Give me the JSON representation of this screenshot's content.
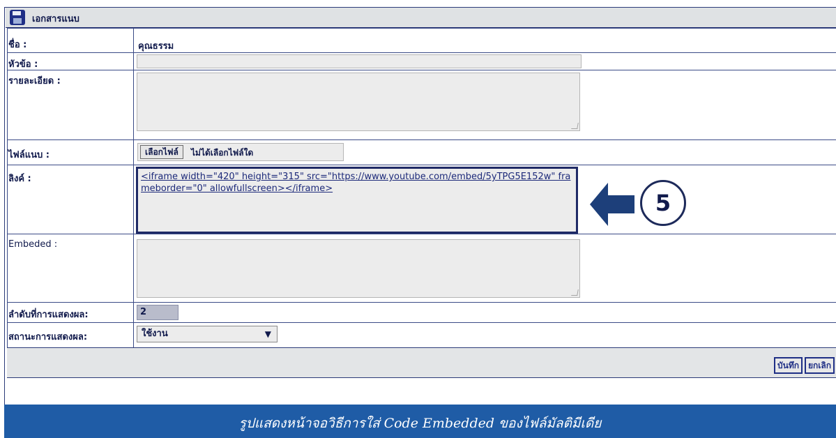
{
  "window": {
    "title": "เอกสารแนบ",
    "title_icon": "floppy-disk-icon"
  },
  "form": {
    "name": {
      "label": "ชื่อ :",
      "value": "คุณธรรม"
    },
    "subject": {
      "label": "หัวข้อ :",
      "value": ""
    },
    "detail": {
      "label": "รายละเอียด :",
      "value": ""
    },
    "attachment": {
      "label": "ไฟล์แนบ :",
      "button_label": "เลือกไฟล์",
      "status": "ไม่ได้เลือกไฟล์ใด"
    },
    "link": {
      "label": "ลิงค์ :",
      "value": "<iframe width=\"420\" height=\"315\" src=\"https://www.youtube.com/embed/5yTPG5E152w\" frameborder=\"0\" allowfullscreen></iframe>"
    },
    "embedded": {
      "label": "Embeded :",
      "value": ""
    },
    "order": {
      "label": "ลำดับที่การแสดงผล:",
      "value": "2"
    },
    "status": {
      "label": "สถานะการแสดงผล:",
      "value": "ใช้งาน",
      "caret": "▼"
    }
  },
  "annotation": {
    "step_number": "5",
    "arrow_icon": "left-arrow-icon",
    "arrow_color": "#1d3f7a"
  },
  "buttons": {
    "save": "บันทึก",
    "cancel": "ยกเลิก"
  },
  "caption": "รูปแสดงหน้าจอวิธีการใส่ Code Embedded ของไฟล์มัลติมีเดีย",
  "colors": {
    "border": "#2b3a78",
    "caption_band": "#1f5ca6",
    "field_bg": "#ececec"
  }
}
